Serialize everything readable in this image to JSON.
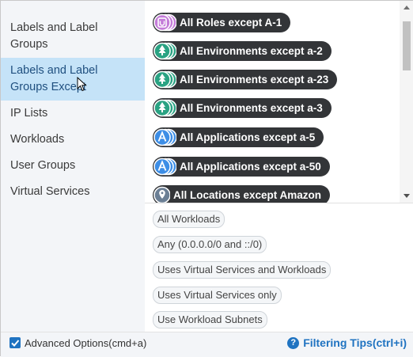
{
  "sidebar": {
    "items": [
      {
        "label": "Labels and Label Groups"
      },
      {
        "label": "Labels and Label Groups Except"
      },
      {
        "label": "IP Lists"
      },
      {
        "label": "Workloads"
      },
      {
        "label": "User Groups"
      },
      {
        "label": "Virtual Services"
      }
    ]
  },
  "chips": [
    {
      "label": "All Roles except A-1",
      "icon": "role-icon",
      "color": "#c37bd8"
    },
    {
      "label": "All Environments except a-2",
      "icon": "tree-icon",
      "color": "#2aa383"
    },
    {
      "label": "All Environments except a-23",
      "icon": "tree-icon",
      "color": "#2aa383"
    },
    {
      "label": "All Environments except a-3",
      "icon": "tree-icon",
      "color": "#2aa383"
    },
    {
      "label": "All Applications except a-5",
      "icon": "app-icon",
      "color": "#3d8ee6"
    },
    {
      "label": "All Applications except a-50",
      "icon": "app-icon",
      "color": "#3d8ee6"
    },
    {
      "label": "All Locations except Amazon",
      "icon": "location-icon",
      "color": "#6b7f95"
    }
  ],
  "options": [
    {
      "label": "All Workloads"
    },
    {
      "label": "Any (0.0.0.0/0 and ::/0)"
    },
    {
      "label": "Uses Virtual Services and Workloads"
    },
    {
      "label": "Uses Virtual Services only"
    },
    {
      "label": "Use Workload Subnets"
    }
  ],
  "footer": {
    "advanced_label": "Advanced Options(cmd+a)",
    "advanced_checked": true,
    "tips_label": "Filtering Tips(ctrl+i)"
  }
}
